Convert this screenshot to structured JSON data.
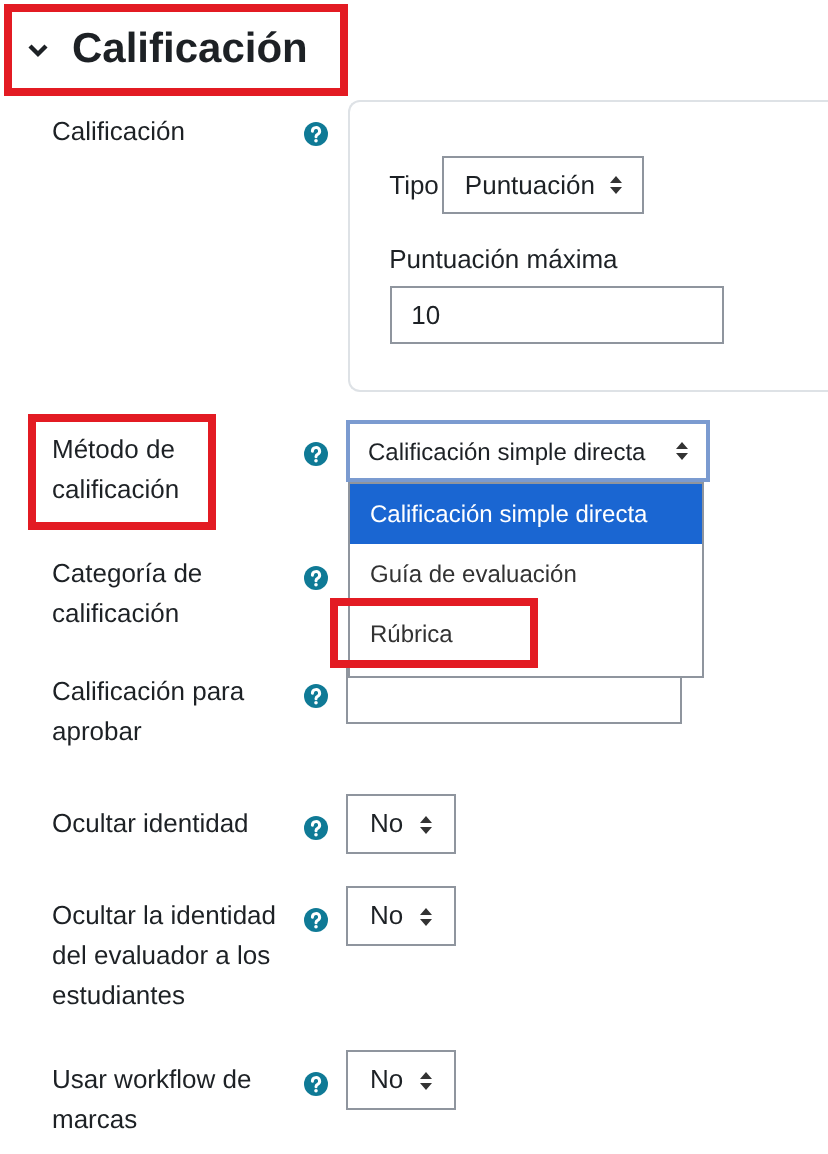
{
  "section": {
    "title": "Calificación",
    "expanded": true,
    "highlighted": true
  },
  "grade": {
    "label": "Calificación",
    "type_label": "Tipo",
    "type_value": "Puntuación",
    "max_label": "Puntuación máxima",
    "max_value": "10"
  },
  "method": {
    "label": "Método de calificación",
    "highlighted": true,
    "value": "Calificación simple directa",
    "open": true,
    "options": [
      {
        "label": "Calificación simple directa",
        "selected": true,
        "highlighted": false
      },
      {
        "label": "Guía de evaluación",
        "selected": false,
        "highlighted": false
      },
      {
        "label": "Rúbrica",
        "selected": false,
        "highlighted": true
      }
    ]
  },
  "category": {
    "label": "Categoría de calificación"
  },
  "pass": {
    "label": "Calificación para aprobar"
  },
  "selects": [
    {
      "label": "Ocultar identidad",
      "value": "No"
    },
    {
      "label": "Ocultar la identidad del evaluador a los estudiantes",
      "value": "No"
    },
    {
      "label": "Usar workflow de marcas",
      "value": "No"
    }
  ]
}
